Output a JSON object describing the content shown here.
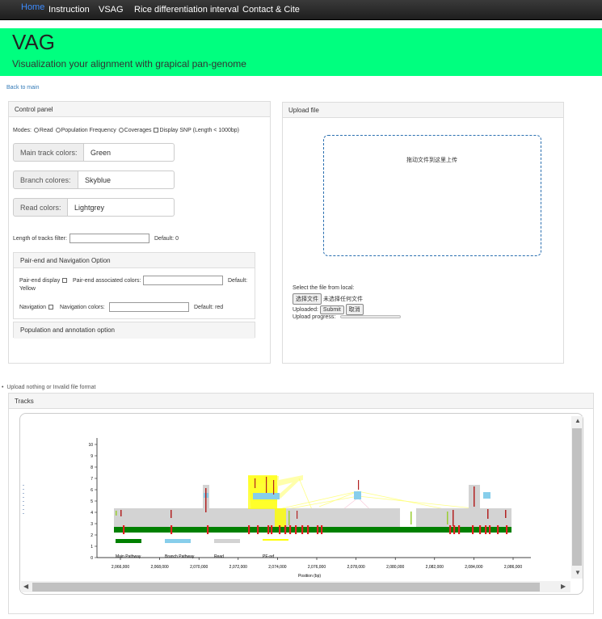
{
  "nav": {
    "items": [
      {
        "label": "Home",
        "active": true
      },
      {
        "label": "Instruction"
      },
      {
        "label": "VSAG"
      },
      {
        "label": "Rice differentiation interval"
      },
      {
        "label": "Contact & Cite"
      }
    ]
  },
  "banner": {
    "title": "VAG",
    "subtitle": "Visualization your alignment with grapical pan-genome",
    "color": "#00ff7f"
  },
  "back_link": "Back to main",
  "control_panel": {
    "title": "Control panel",
    "modes_label": "Modes:",
    "modes": [
      "Read",
      "Population Frequency",
      "Coverages"
    ],
    "display_snp": "Display SNP",
    "snp_hint": "(Length < 1000bp)",
    "main_track_label": "Main track colors:",
    "main_track_value": "Green",
    "branch_label": "Branch colores:",
    "branch_value": "Skyblue",
    "read_label": "Read colors:",
    "read_value": "Lightgrey",
    "length_filter_label": "Length of tracks filter:",
    "length_filter_default": "Default: 0",
    "pair_end_panel": {
      "title": "Pair-end and Navigation Option",
      "pair_end_display": "Pair-end display",
      "pair_end_colors_label": "Pair-end associated colors:",
      "pair_end_default": "Default:",
      "pair_end_default_value": "Yellow",
      "navigation": "Navigation",
      "navigation_colors_label": "Navigation colors:",
      "navigation_default": "Default: red"
    },
    "population_panel": {
      "title": "Population and annotation option"
    }
  },
  "upload_panel": {
    "title": "Upload file",
    "dropzone_text": "拖动文件到这里上传",
    "select_label": "Select the file from local:",
    "choose_button": "选择文件",
    "no_file": "未选择任何文件",
    "uploaded_label": "Uploaded:",
    "submit_button": "Submit",
    "cancel_button": "取消",
    "progress_label": "Upload progress:",
    "progress": 0
  },
  "status_message": "Upload nothing or Invalid file format",
  "tracks": {
    "title": "Tracks",
    "y_ticks": [
      "0",
      "1",
      "2",
      "3",
      "4",
      "5",
      "6",
      "7",
      "8",
      "9",
      "10"
    ],
    "x_ticks": [
      "2,066,000",
      "2,068,000",
      "2,070,000",
      "2,072,000",
      "2,074,000",
      "2,076,000",
      "2,078,000",
      "2,080,000",
      "2,082,000",
      "2,084,000",
      "2,086,000"
    ],
    "x_label": "Position (bp)",
    "legend": [
      {
        "label": "Main Pathway",
        "color": "#008000"
      },
      {
        "label": "Branch Pathway",
        "color": "#87ceeb"
      },
      {
        "label": "Read",
        "color": "#d3d3d3"
      },
      {
        "label": "PE-ref",
        "color": "#ffff00"
      }
    ]
  }
}
